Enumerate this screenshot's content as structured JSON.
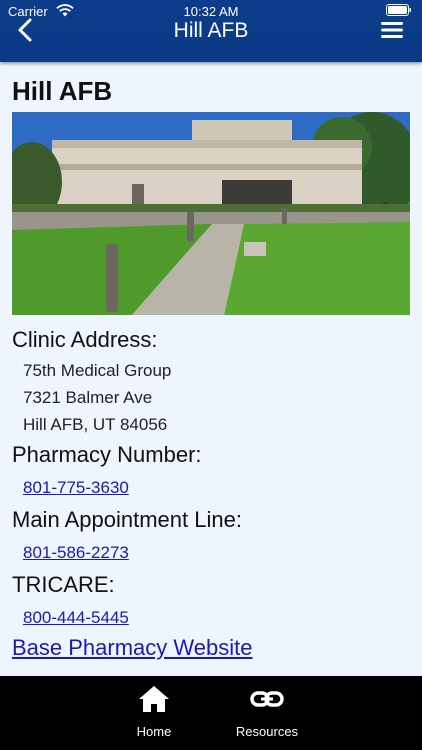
{
  "status_bar": {
    "carrier": "Carrier",
    "time": "10:32 AM",
    "wifi_icon": "wifi-icon",
    "battery_icon": "battery-icon"
  },
  "nav": {
    "title": "Hill AFB",
    "back_icon": "chevron-left-icon",
    "menu_icon": "hamburger-menu-icon"
  },
  "page": {
    "title": "Hill AFB",
    "photo_description_icon": "clinic-building-photo"
  },
  "clinic": {
    "address_label": "Clinic Address:",
    "address_lines": [
      "75th Medical Group",
      "7321 Balmer Ave",
      "Hill AFB, UT 84056"
    ]
  },
  "pharmacy": {
    "label": "Pharmacy Number:",
    "phone": "801-775-3630"
  },
  "appointment": {
    "label": "Main Appointment Line:",
    "phone": "801-586-2273"
  },
  "tricare": {
    "label": "TRICARE:",
    "phone": "800-444-5445"
  },
  "website": {
    "label": "Base Pharmacy Website"
  },
  "tab_bar": {
    "home_label": "Home",
    "resources_label": "Resources",
    "background": "#000000"
  },
  "colors": {
    "header": "#0b3d8a",
    "background": "#eef5fd",
    "link": "#1a1ab8"
  }
}
